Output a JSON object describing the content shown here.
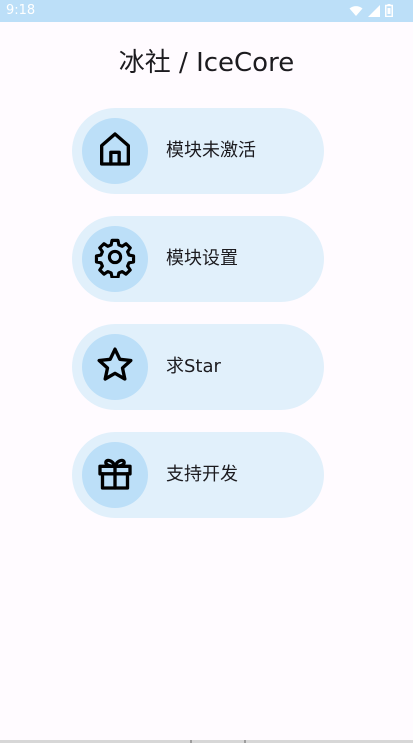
{
  "status_bar": {
    "time": "9:18",
    "icons": [
      "wifi-icon",
      "signal-icon",
      "battery-icon"
    ]
  },
  "header": {
    "title": "冰社 / IceCore"
  },
  "menu": {
    "items": [
      {
        "label": "模块未激活",
        "icon": "home-icon"
      },
      {
        "label": "模块设置",
        "icon": "gear-icon"
      },
      {
        "label": "求Star",
        "icon": "star-icon"
      },
      {
        "label": "支持开发",
        "icon": "gift-icon"
      }
    ]
  },
  "colors": {
    "background": "#fffbff",
    "status_bar": "#bcdff8",
    "card": "#e1f0fb",
    "icon_circle": "#bcdff8",
    "text": "#1c1b1f"
  }
}
